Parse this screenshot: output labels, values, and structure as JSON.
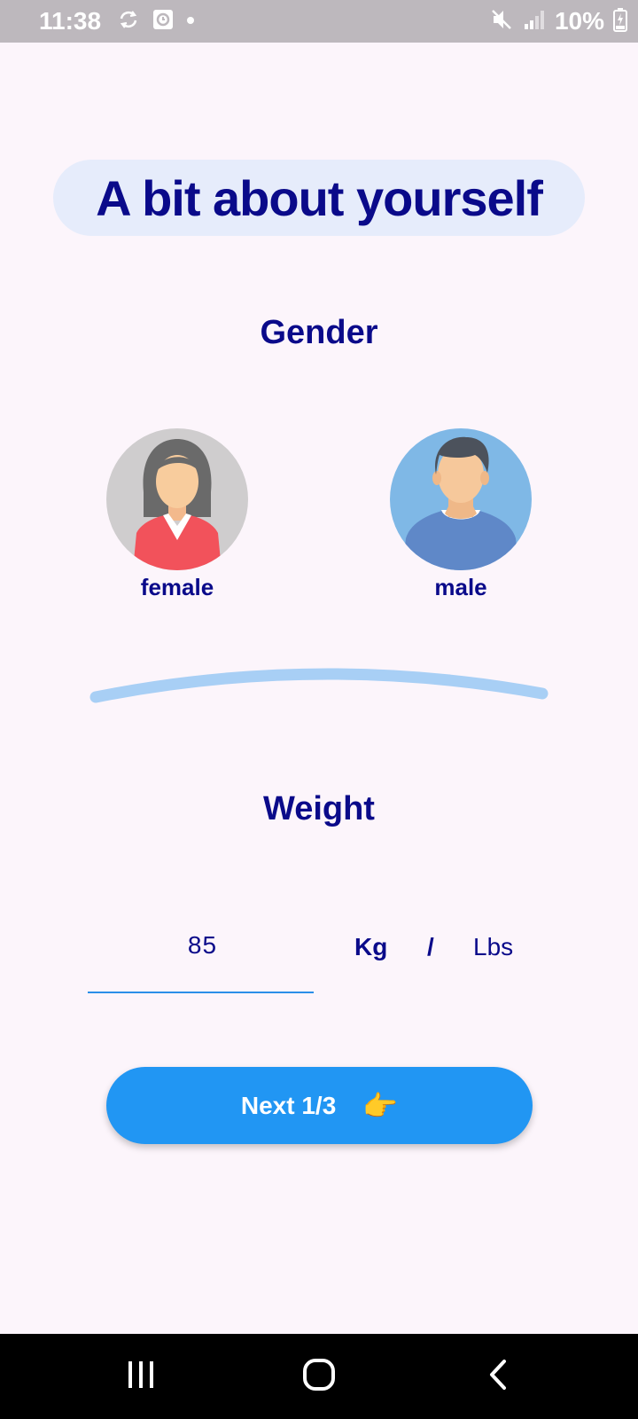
{
  "status_bar": {
    "time": "11:38",
    "battery_text": "10%",
    "icons_left": [
      "sync-icon",
      "clock-app-icon",
      "dot-icon"
    ],
    "icons_right": [
      "mute-icon",
      "signal-icon",
      "battery-charging-icon"
    ]
  },
  "title": "A bit about yourself",
  "gender": {
    "heading": "Gender",
    "options": [
      {
        "label": "female",
        "icon": "female-avatar-icon"
      },
      {
        "label": "male",
        "icon": "male-avatar-icon"
      }
    ]
  },
  "weight": {
    "heading": "Weight",
    "value": "85",
    "unit_kg": "Kg",
    "unit_separator": "/",
    "unit_lbs": "Lbs",
    "selected_unit": "Kg"
  },
  "next_button": {
    "label": "Next 1/3",
    "icon": "👉"
  },
  "nav_bar": {
    "buttons": [
      "recents-icon",
      "home-icon",
      "back-icon"
    ]
  },
  "colors": {
    "primary_text": "#0a0a8a",
    "accent": "#2196f3",
    "title_pill_bg": "#e6ecfb",
    "divider": "#a8cff5",
    "background": "#fcf5fb"
  }
}
